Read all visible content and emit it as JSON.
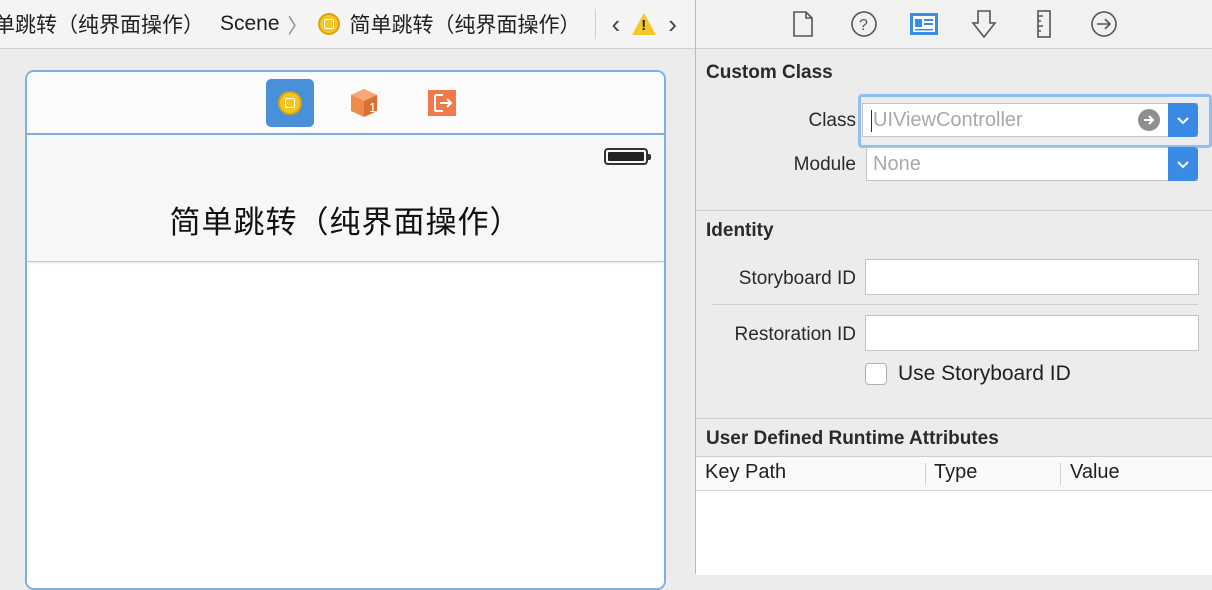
{
  "breadcrumb": {
    "items": [
      "单跳转（纯界面操作）",
      "Scene",
      "简单跳转（纯界面操作）"
    ],
    "warning_glyph": "!"
  },
  "canvas": {
    "dock_icons": [
      "view-controller-icon",
      "first-responder-icon",
      "exit-icon"
    ],
    "first_responder_badge": "1",
    "nav_title": "简单跳转（纯界面操作）"
  },
  "inspector": {
    "tabs": [
      "file-inspector-icon",
      "quick-help-icon",
      "identity-inspector-icon",
      "attributes-inspector-icon",
      "size-inspector-icon",
      "connections-inspector-icon"
    ],
    "custom_class": {
      "title": "Custom Class",
      "class_label": "Class",
      "class_placeholder": "UIViewController",
      "module_label": "Module",
      "module_placeholder": "None"
    },
    "identity": {
      "title": "Identity",
      "storyboard_id_label": "Storyboard ID",
      "storyboard_id_value": "",
      "restoration_id_label": "Restoration ID",
      "restoration_id_value": "",
      "use_storyboard_id_label": "Use Storyboard ID",
      "use_storyboard_id_checked": false
    },
    "runtime_attributes": {
      "title": "User Defined Runtime Attributes",
      "columns": [
        "Key Path",
        "Type",
        "Value"
      ]
    }
  },
  "colors": {
    "accent": "#3a8be5",
    "selection_border": "#7eb0db",
    "vc_yellow": "#f6c624",
    "first_responder_orange": "#f08a4b",
    "exit_orange": "#f2794a"
  }
}
